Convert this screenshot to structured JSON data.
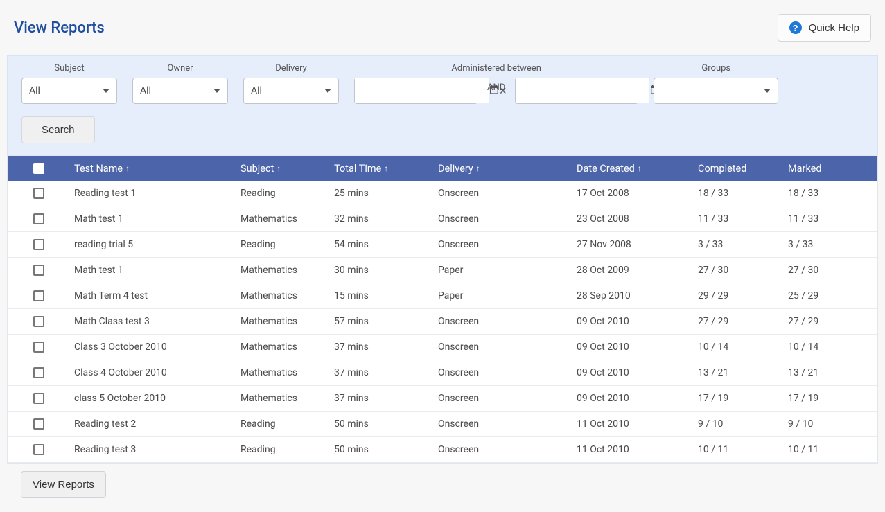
{
  "page": {
    "title": "View Reports",
    "quick_help_label": "Quick Help"
  },
  "filters": {
    "subject": {
      "label": "Subject",
      "value": "All"
    },
    "owner": {
      "label": "Owner",
      "value": "All"
    },
    "delivery": {
      "label": "Delivery",
      "value": "All"
    },
    "administered_label": "Administered between",
    "and_label": "AND",
    "groups": {
      "label": "Groups",
      "value": ""
    },
    "date_from": "",
    "date_to": "",
    "search_label": "Search"
  },
  "table": {
    "headers": {
      "test_name": "Test Name",
      "subject": "Subject",
      "total_time": "Total Time",
      "delivery": "Delivery",
      "date_created": "Date Created",
      "completed": "Completed",
      "marked": "Marked"
    },
    "rows": [
      {
        "name": "Reading test 1",
        "subject": "Reading",
        "time": "25 mins",
        "delivery": "Onscreen",
        "created": "17 Oct 2008",
        "completed": "18 / 33",
        "marked": "18 / 33"
      },
      {
        "name": "Math test 1",
        "subject": "Mathematics",
        "time": "32 mins",
        "delivery": "Onscreen",
        "created": "23 Oct 2008",
        "completed": "11 / 33",
        "marked": "11 / 33"
      },
      {
        "name": "reading trial 5",
        "subject": "Reading",
        "time": "54 mins",
        "delivery": "Onscreen",
        "created": "27 Nov 2008",
        "completed": "3 / 33",
        "marked": "3 / 33"
      },
      {
        "name": "Math test 1",
        "subject": "Mathematics",
        "time": "30 mins",
        "delivery": "Paper",
        "created": "28 Oct 2009",
        "completed": "27 / 30",
        "marked": "27 / 30"
      },
      {
        "name": "Math Term 4 test",
        "subject": "Mathematics",
        "time": "15 mins",
        "delivery": "Paper",
        "created": "28 Sep 2010",
        "completed": "29 / 29",
        "marked": "25 / 29"
      },
      {
        "name": "Math Class test 3",
        "subject": "Mathematics",
        "time": "57 mins",
        "delivery": "Onscreen",
        "created": "09 Oct 2010",
        "completed": "27 / 29",
        "marked": "27 / 29"
      },
      {
        "name": "Class 3 October 2010",
        "subject": "Mathematics",
        "time": "37 mins",
        "delivery": "Onscreen",
        "created": "09 Oct 2010",
        "completed": "10 / 14",
        "marked": "10 / 14"
      },
      {
        "name": "Class 4 October 2010",
        "subject": "Mathematics",
        "time": "37 mins",
        "delivery": "Onscreen",
        "created": "09 Oct 2010",
        "completed": "13 / 21",
        "marked": "13 / 21"
      },
      {
        "name": "class 5 October 2010",
        "subject": "Mathematics",
        "time": "37 mins",
        "delivery": "Onscreen",
        "created": "09 Oct 2010",
        "completed": "17 / 19",
        "marked": "17 / 19"
      },
      {
        "name": "Reading test 2",
        "subject": "Reading",
        "time": "50 mins",
        "delivery": "Onscreen",
        "created": "11 Oct 2010",
        "completed": "9 / 10",
        "marked": "9 / 10"
      },
      {
        "name": "Reading test 3",
        "subject": "Reading",
        "time": "50 mins",
        "delivery": "Onscreen",
        "created": "11 Oct 2010",
        "completed": "10 / 11",
        "marked": "10 / 11"
      }
    ]
  },
  "footer": {
    "view_reports_label": "View Reports"
  }
}
